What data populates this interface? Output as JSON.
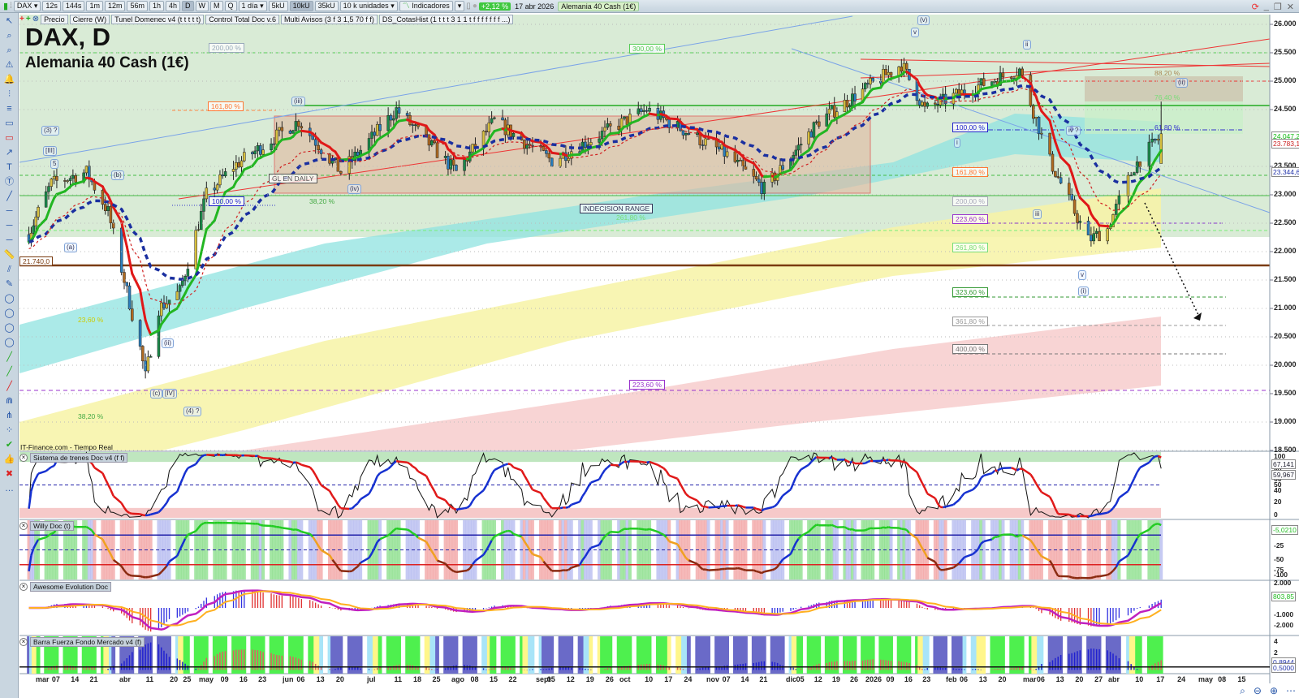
{
  "toolbar": {
    "symbol": "DAX",
    "intervals": [
      "12s",
      "144s",
      "1m",
      "12m",
      "56m",
      "1h",
      "4h",
      "D",
      "W",
      "M",
      "Q"
    ],
    "active_interval": "D",
    "period": "1 día",
    "units": [
      "5kU",
      "10kU",
      "35kU"
    ],
    "active_unit": "10kU",
    "unit_select": "10 k unidades",
    "indicators": "Indicadores",
    "change": "+2,12 %",
    "date": "17 abr 2026",
    "instrument": "Alemania 40 Cash (1€)"
  },
  "indicator_bar": [
    "Precio",
    "Cierre (W)",
    "Tunel Domenec v4 (t t t t t)",
    "Control Total Doc v.6",
    "Multi Avisos (3 f 3 1,5 70 f f)",
    "DS_CotasHist (1 t t t 3 1 1 t f f f f f f f ...)"
  ],
  "header": {
    "title": "DAX, D",
    "subtitle": "Alemania 40 Cash (1€)",
    "source": "IT-Finance.com - Tiempo Real"
  },
  "level_21740": "21.740,0",
  "fib_labels": [
    "200,00 %",
    "300,00 %",
    "161,80 %",
    "100,00 %",
    "38,20 %",
    "GL EN DAILY",
    "INDECISION RANGE",
    "261,80 %",
    "23,60 %",
    "38,20 %",
    "223,60 %",
    "88,20 %",
    "76,40 %",
    "100,00 %",
    "61,80 %",
    "161,80 %",
    "200,00 %",
    "223,60 %",
    "261,80 %",
    "323,60 %",
    "361,80 %",
    "400,00 %"
  ],
  "wave_labels": [
    "(3) ?",
    "[III]",
    "(b)",
    "(a)",
    "(iii)",
    "(iv)",
    "(ii)",
    "(c)",
    "[IV]",
    "(4) ?",
    "v",
    "(v)",
    "ii",
    "(ii)",
    "iv ?",
    "i",
    "iii",
    "v",
    "(i)",
    "5"
  ],
  "price_axis": [
    26000,
    25500,
    25000,
    24500,
    24000,
    23500,
    23000,
    22500,
    22000,
    21500,
    21000,
    20500,
    20000,
    19500,
    19000,
    18500
  ],
  "price_axis_labels": [
    "26.000",
    "25.500",
    "25.000",
    "24.500",
    "",
    "23.500",
    "23.000",
    "22.500",
    "22.000",
    "21.500",
    "21.000",
    "20.500",
    "20.000",
    "19.500",
    "19.000",
    "18.500"
  ],
  "price_tags": {
    "green": "24.047,2",
    "red": "23.783,1",
    "blue": "23.344,6"
  },
  "colors": {
    "bg_zone": "#d9ebd6",
    "up": "#2fb82f",
    "down": "#e82020",
    "slow": "#1a2fa0",
    "cyan": "#8fe3e0",
    "yellow": "#f7f3a6",
    "pink": "#f8d4d4"
  },
  "panels": [
    {
      "title": "Sistema de trenes Doc v4 (f f)",
      "axis": [
        "100",
        "80",
        "60",
        "50",
        "40",
        "20",
        "0"
      ],
      "tags": [
        "67,141",
        "59,967"
      ]
    },
    {
      "title": "Willy Doc (t)",
      "axis": [
        "-25",
        "-50",
        "-75",
        "-100"
      ],
      "tags": [
        "-5,0210"
      ]
    },
    {
      "title": "Awesome Evolution Doc",
      "axis": [
        "2.000",
        "0",
        "-1.000",
        "-2.000"
      ],
      "tags": [
        "803,85"
      ]
    },
    {
      "title": "Barra Fuerza Fondo Mercado v4 (f)",
      "axis": [
        "4",
        "2"
      ],
      "tags": [
        "0,8944",
        "0,5000"
      ]
    }
  ],
  "time_axis": [
    [
      "mar",
      "2025-03-01"
    ],
    [
      "07",
      "2025-03-07"
    ],
    [
      "14",
      "2025-03-14"
    ],
    [
      "21",
      "2025-03-21"
    ],
    [
      "abr",
      "2025-04-01"
    ],
    [
      "11",
      "2025-04-11"
    ],
    [
      "20",
      "2025-04-20"
    ],
    [
      "25",
      "2025-04-25"
    ],
    [
      "may",
      "2025-05-01"
    ],
    [
      "09",
      "2025-05-09"
    ],
    [
      "16",
      "2025-05-16"
    ],
    [
      "23",
      "2025-05-23"
    ],
    [
      "jun",
      "2025-06-01"
    ],
    [
      "06",
      "2025-06-06"
    ],
    [
      "13",
      "2025-06-13"
    ],
    [
      "20",
      "2025-06-20"
    ],
    [
      "jul",
      "2025-07-01"
    ],
    [
      "11",
      "2025-07-11"
    ],
    [
      "18",
      "2025-07-18"
    ],
    [
      "25",
      "2025-07-25"
    ],
    [
      "ago",
      "2025-08-01"
    ],
    [
      "08",
      "2025-08-08"
    ],
    [
      "15",
      "2025-08-15"
    ],
    [
      "22",
      "2025-08-22"
    ],
    [
      "sept",
      "2025-09-01"
    ],
    [
      "05",
      "2025-09-05"
    ],
    [
      "12",
      "2025-09-12"
    ],
    [
      "19",
      "2025-09-19"
    ],
    [
      "26",
      "2025-09-26"
    ],
    [
      "oct",
      "2025-10-01"
    ],
    [
      "10",
      "2025-10-10"
    ],
    [
      "17",
      "2025-10-17"
    ],
    [
      "24",
      "2025-10-24"
    ],
    [
      "nov",
      "2025-11-01"
    ],
    [
      "07",
      "2025-11-07"
    ],
    [
      "14",
      "2025-11-14"
    ],
    [
      "21",
      "2025-11-21"
    ],
    [
      "dic",
      "2025-12-01"
    ],
    [
      "05",
      "2025-12-05"
    ],
    [
      "12",
      "2025-12-12"
    ],
    [
      "19",
      "2025-12-19"
    ],
    [
      "26",
      "2025-12-26"
    ],
    [
      "2026",
      "2026-01-01"
    ],
    [
      "09",
      "2026-01-09"
    ],
    [
      "16",
      "2026-01-16"
    ],
    [
      "23",
      "2026-01-23"
    ],
    [
      "feb",
      "2026-02-01"
    ],
    [
      "06",
      "2026-02-06"
    ],
    [
      "13",
      "2026-02-13"
    ],
    [
      "20",
      "2026-02-20"
    ],
    [
      "mar",
      "2026-03-01"
    ],
    [
      "06",
      "2026-03-06"
    ],
    [
      "13",
      "2026-03-13"
    ],
    [
      "20",
      "2026-03-20"
    ],
    [
      "27",
      "2026-03-27"
    ],
    [
      "abr",
      "2026-04-01"
    ],
    [
      "10",
      "2026-04-10"
    ],
    [
      "17",
      "2026-04-17"
    ],
    [
      "24",
      "2026-04-24"
    ],
    [
      "may",
      "2026-05-01"
    ],
    [
      "08",
      "2026-05-08"
    ],
    [
      "15",
      "2026-05-15"
    ]
  ],
  "chart_data": {
    "type": "candlestick",
    "title": "DAX, D",
    "key_closes": [
      [
        "2025-02-24",
        22300
      ],
      [
        "2025-03-05",
        23200
      ],
      [
        "2025-03-18",
        23400
      ],
      [
        "2025-03-26",
        22700
      ],
      [
        "2025-04-07",
        20300
      ],
      [
        "2025-04-09",
        19800
      ],
      [
        "2025-04-14",
        21000
      ],
      [
        "2025-04-22",
        21300
      ],
      [
        "2025-05-02",
        23000
      ],
      [
        "2025-05-12",
        23500
      ],
      [
        "2025-06-05",
        24300
      ],
      [
        "2025-06-20",
        23400
      ],
      [
        "2025-07-10",
        24500
      ],
      [
        "2025-08-01",
        23400
      ],
      [
        "2025-08-15",
        24300
      ],
      [
        "2025-09-05",
        23600
      ],
      [
        "2025-10-09",
        24500
      ],
      [
        "2025-11-07",
        23700
      ],
      [
        "2025-11-21",
        23100
      ],
      [
        "2025-12-12",
        24300
      ],
      [
        "2026-01-13",
        25300
      ],
      [
        "2026-01-22",
        24500
      ],
      [
        "2026-02-10",
        24900
      ],
      [
        "2026-02-26",
        25200
      ],
      [
        "2026-03-09",
        23600
      ],
      [
        "2026-03-23",
        22200
      ],
      [
        "2026-03-30",
        22400
      ],
      [
        "2026-04-08",
        23500
      ],
      [
        "2026-04-17",
        24050
      ]
    ],
    "ylim": [
      18500,
      26000
    ]
  }
}
